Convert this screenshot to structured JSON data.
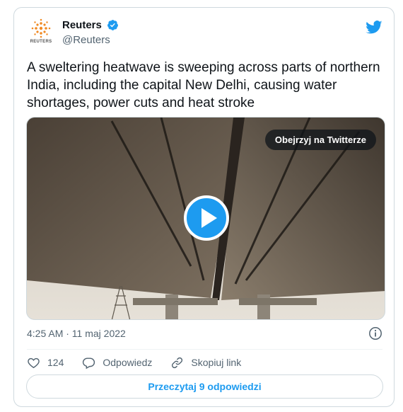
{
  "author": {
    "display_name": "Reuters",
    "handle": "@Reuters",
    "avatar_wordmark": "REUTERS",
    "verified": true
  },
  "tweet": {
    "text": "A sweltering heatwave is sweeping across parts of northern India, including the capital New Delhi, causing water shortages, power cuts and heat stroke",
    "timestamp": "4:25 AM · 11 maj 2022"
  },
  "media": {
    "watch_label": "Obejrzyj na Twitterze",
    "type": "video"
  },
  "actions": {
    "like_count": "124",
    "reply_label": "Odpowiedz",
    "copy_link_label": "Skopiuj link"
  },
  "footer": {
    "read_replies_label": "Przeczytaj 9 odpowiedzi"
  },
  "colors": {
    "accent": "#1d9bf0",
    "text": "#0f1419",
    "muted": "#536471",
    "border": "#cfd9de"
  },
  "icons": [
    "reuters-logo-icon",
    "verified-badge-icon",
    "twitter-bird-icon",
    "play-icon",
    "info-icon",
    "heart-icon",
    "reply-icon",
    "link-icon"
  ]
}
